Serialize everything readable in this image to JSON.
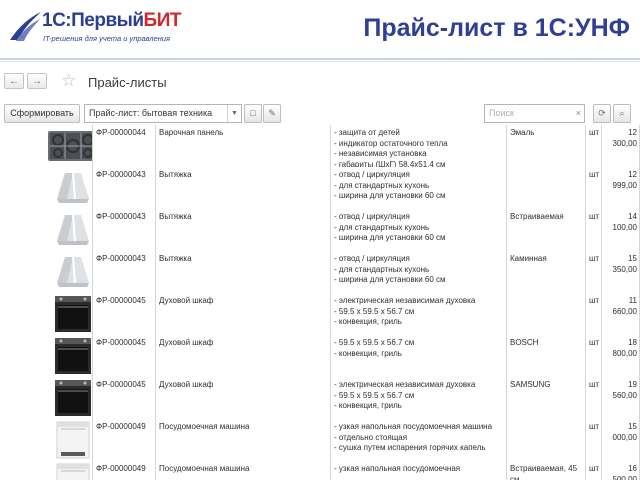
{
  "header": {
    "logo_prefix": "1С:",
    "logo_main": "Первый",
    "logo_accent": "БИТ",
    "logo_tagline": "IT-решения для учета и управления",
    "title": "Прайс-лист в 1С:УНФ"
  },
  "window": {
    "back_icon": "arrow-left-icon",
    "forward_icon": "arrow-right-icon",
    "favorite_icon": "star-icon",
    "form_title": "Прайс-листы"
  },
  "toolbar": {
    "generate_label": "Сформировать",
    "pricelist_value": "Прайс-лист: бытовая техника",
    "search_placeholder": "Поиск",
    "search_clear": "×"
  },
  "rows": [
    {
      "image": "hob",
      "code": "ФР-00000044",
      "name": "Варочная панель",
      "features": "- защита от детей\n- индикатор остаточного тепла\n- независимая установка\n- габариты (ШхГ) 58.4х51.4 см",
      "variant": "Эмаль",
      "unit": "шт",
      "price": "12 300,00"
    },
    {
      "image": "hood",
      "code": "ФР-00000043",
      "name": "Вытяжка",
      "features": "- отвод / циркуляция\n- для стандартных кухонь\n- ширина для установки 60 см",
      "variant": "",
      "unit": "шт",
      "price": "12 999,00"
    },
    {
      "image": "hood",
      "code": "ФР-00000043",
      "name": "Вытяжка",
      "features": "- отвод / циркуляция\n- для стандартных кухонь\n- ширина для установки 60 см",
      "variant": "Встраиваемая",
      "unit": "шт",
      "price": "14 100,00"
    },
    {
      "image": "hood",
      "code": "ФР-00000043",
      "name": "Вытяжка",
      "features": "- отвод / циркуляция\n- для стандартных кухонь\n- ширина для установки 60 см",
      "variant": "Каминная",
      "unit": "шт",
      "price": "15 350,00"
    },
    {
      "image": "oven",
      "code": "ФР-00000045",
      "name": "Духовой шкаф",
      "features": "- электрическая независимая духовка\n- 59.5 x 59.5 x 56.7 см\n- конвекция, гриль",
      "variant": "",
      "unit": "шт",
      "price": "11 660,00"
    },
    {
      "image": "oven",
      "code": "ФР-00000045",
      "name": "Духовой шкаф",
      "features": "- 59.5 x 59.5 x 56.7 см\n- конвекция, гриль",
      "variant": "BOSCH",
      "unit": "шт",
      "price": "18 800,00"
    },
    {
      "image": "oven",
      "code": "ФР-00000045",
      "name": "Духовой шкаф",
      "features": "- электрическая независимая духовка\n- 59.5 x 59.5 x 56.7 см\n- конвекция, гриль",
      "variant": "SAMSUNG",
      "unit": "шт",
      "price": "19 560,00"
    },
    {
      "image": "dishwasher",
      "code": "ФР-00000049",
      "name": "Посудомоечная машина",
      "features": "- узкая напольная посудомоечная машина\n- отдельно стоящая\n- сушка путем испарения горячих капель",
      "variant": "",
      "unit": "шт",
      "price": "15 000,00"
    },
    {
      "image": "dishwasher",
      "code": "ФР-00000049",
      "name": "Посудомоечная машина",
      "features": "- узкая напольная посудомоечная",
      "variant": "Встраиваемая, 45 см",
      "unit": "шт",
      "price": "16 500,00"
    }
  ]
}
